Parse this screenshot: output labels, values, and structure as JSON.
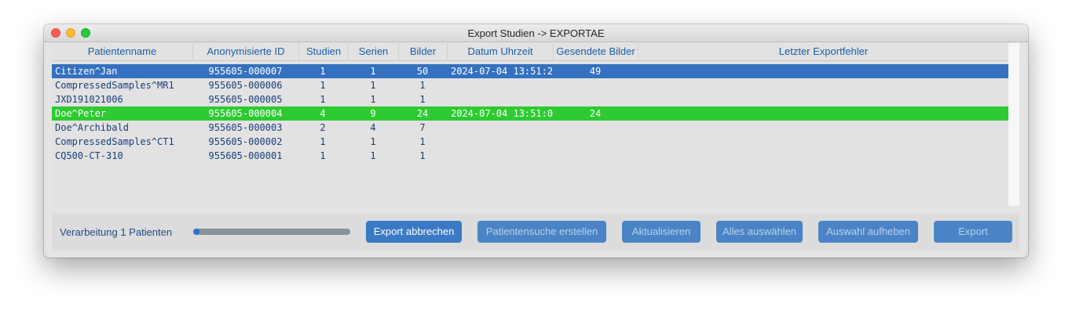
{
  "window": {
    "title": "Export Studien -> EXPORTAE"
  },
  "table": {
    "columns": [
      "Patientenname",
      "Anonymisierte ID",
      "Studien",
      "Serien",
      "Bilder",
      "Datum Uhrzeit",
      "Gesendete Bilder",
      "Letzter Exportfehler"
    ],
    "rows": [
      {
        "name": "Citizen^Jan",
        "id": "955605-000007",
        "studies": "1",
        "series": "1",
        "images": "50",
        "datetime": "2024-07-04 13:51:2",
        "sent": "49",
        "error": "",
        "state": "selected"
      },
      {
        "name": "CompressedSamples^MR1",
        "id": "955605-000006",
        "studies": "1",
        "series": "1",
        "images": "1",
        "datetime": "",
        "sent": "",
        "error": "",
        "state": "normal"
      },
      {
        "name": "JXD191021006",
        "id": "955605-000005",
        "studies": "1",
        "series": "1",
        "images": "1",
        "datetime": "",
        "sent": "",
        "error": "",
        "state": "normal"
      },
      {
        "name": "Doe^Peter",
        "id": "955605-000004",
        "studies": "4",
        "series": "9",
        "images": "24",
        "datetime": "2024-07-04 13:51:0",
        "sent": "24",
        "error": "",
        "state": "done"
      },
      {
        "name": "Doe^Archibald",
        "id": "955605-000003",
        "studies": "2",
        "series": "4",
        "images": "7",
        "datetime": "",
        "sent": "",
        "error": "",
        "state": "normal"
      },
      {
        "name": "CompressedSamples^CT1",
        "id": "955605-000002",
        "studies": "1",
        "series": "1",
        "images": "1",
        "datetime": "",
        "sent": "",
        "error": "",
        "state": "normal"
      },
      {
        "name": "CQ500-CT-310",
        "id": "955605-000001",
        "studies": "1",
        "series": "1",
        "images": "1",
        "datetime": "",
        "sent": "",
        "error": "",
        "state": "normal"
      }
    ]
  },
  "footer": {
    "status_text": "Verarbeitung 1 Patienten",
    "progress_fraction": 0.04,
    "buttons": {
      "abort": "Export abbrechen",
      "patient_search": "Patientensuche erstellen",
      "refresh": "Aktualisieren",
      "select_all": "Alles auswählen",
      "deselect": "Auswahl aufheben",
      "export": "Export"
    }
  },
  "colors": {
    "selected_row": "#3471c0",
    "done_row": "#2dcb31",
    "button": "#3a79c4",
    "header_text": "#1a5ea8"
  }
}
